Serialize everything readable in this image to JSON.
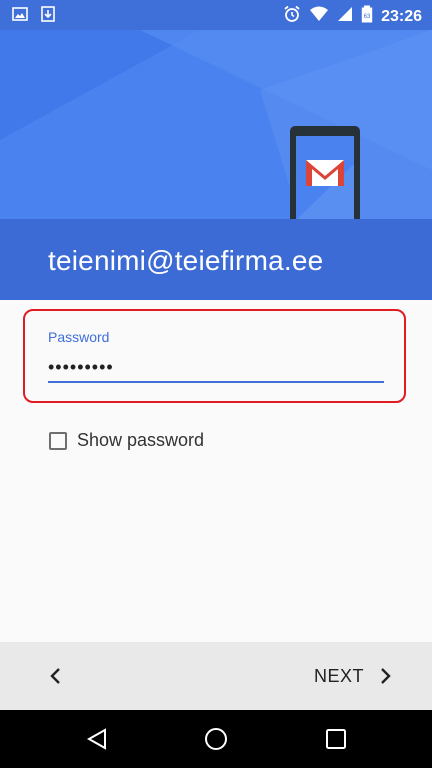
{
  "status_bar": {
    "time": "23:26",
    "left_icons": [
      "image-icon",
      "download-icon"
    ],
    "right_icons": [
      "alarm-icon",
      "wifi-icon",
      "signal-icon",
      "battery-icon"
    ]
  },
  "header": {
    "account_email": "teienimi@teiefirma.ee",
    "accent_color": "#3c6bd6",
    "illustration": "gmail-device-icon"
  },
  "password_field": {
    "label": "Password",
    "value": "•••••••••",
    "highlight_color": "#e11b22"
  },
  "show_password": {
    "label": "Show password",
    "checked": false
  },
  "action_bar": {
    "back_icon": "chevron-left-icon",
    "next_label": "NEXT",
    "next_icon": "chevron-right-icon"
  },
  "nav_bar": {
    "icons": [
      "back-triangle-icon",
      "home-circle-icon",
      "recents-square-icon"
    ]
  }
}
